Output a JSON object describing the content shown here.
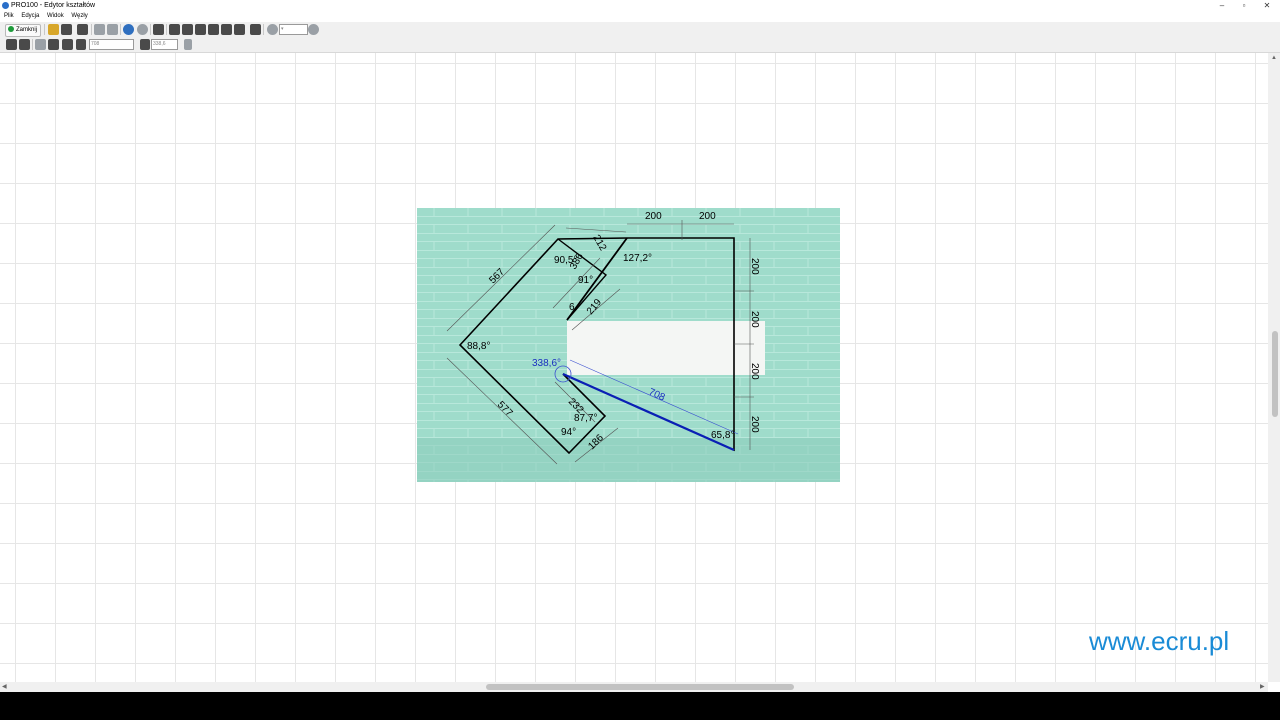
{
  "window": {
    "title": "PRO100 - Edytor kształtów"
  },
  "menu": [
    "Plik",
    "Edycja",
    "Widok",
    "Węzły"
  ],
  "toolbar": {
    "close_label": "Zamknij",
    "length_value": "708",
    "angle_value": "338,6"
  },
  "drawing": {
    "dims_top": [
      "200",
      "200"
    ],
    "dims_right": [
      "200",
      "200",
      "200",
      "200"
    ],
    "dim_567": "567",
    "dim_577": "577",
    "dim_212": "212",
    "dim_386": "386",
    "dim_219": "219",
    "dim_232": "232",
    "dim_186": "186",
    "dim_708": "708",
    "angle_90_5": "90,5°",
    "angle_127_2": "127,2°",
    "angle_91": "91°",
    "angle_6x": "6",
    "angle_88_8": "88,8°",
    "angle_338_6": "338,6°",
    "angle_87_7": "87,7°",
    "angle_94": "94°",
    "angle_65_8": "65,8°"
  },
  "watermark": "www.ecru.pl",
  "colors": {
    "photo_teal": "#9fdccb",
    "shape_line": "#000000",
    "selected_line": "#0a1fb5",
    "watermark": "#1a8bd6"
  }
}
